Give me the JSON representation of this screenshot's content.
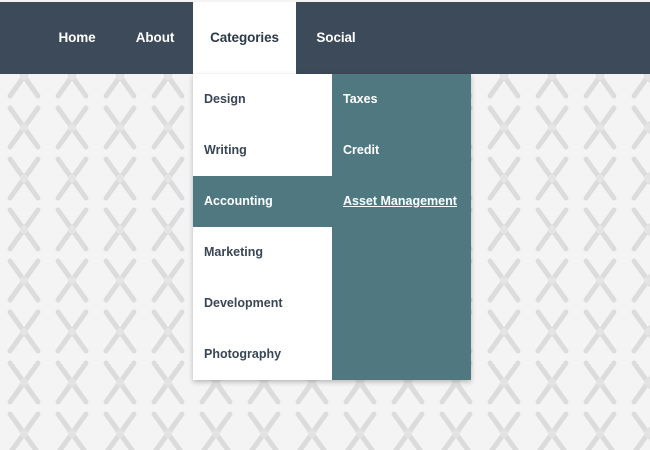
{
  "nav": {
    "items": [
      {
        "label": "Home"
      },
      {
        "label": "About"
      },
      {
        "label": "Categories",
        "active": true
      },
      {
        "label": "Social"
      }
    ]
  },
  "dropdown": {
    "items": [
      {
        "label": "Design"
      },
      {
        "label": "Writing"
      },
      {
        "label": "Accounting",
        "active": true
      },
      {
        "label": "Marketing"
      },
      {
        "label": "Development"
      },
      {
        "label": "Photography"
      }
    ],
    "submenu": {
      "items": [
        {
          "label": "Taxes"
        },
        {
          "label": "Credit"
        },
        {
          "label": "Asset Management",
          "hovered": true
        }
      ]
    }
  },
  "colors": {
    "navbar_bg": "#3d4a59",
    "active_bg": "#4f7880",
    "page_bg": "#f4f4f4",
    "text_dark": "#3a4655",
    "text_light": "#ffffff"
  }
}
